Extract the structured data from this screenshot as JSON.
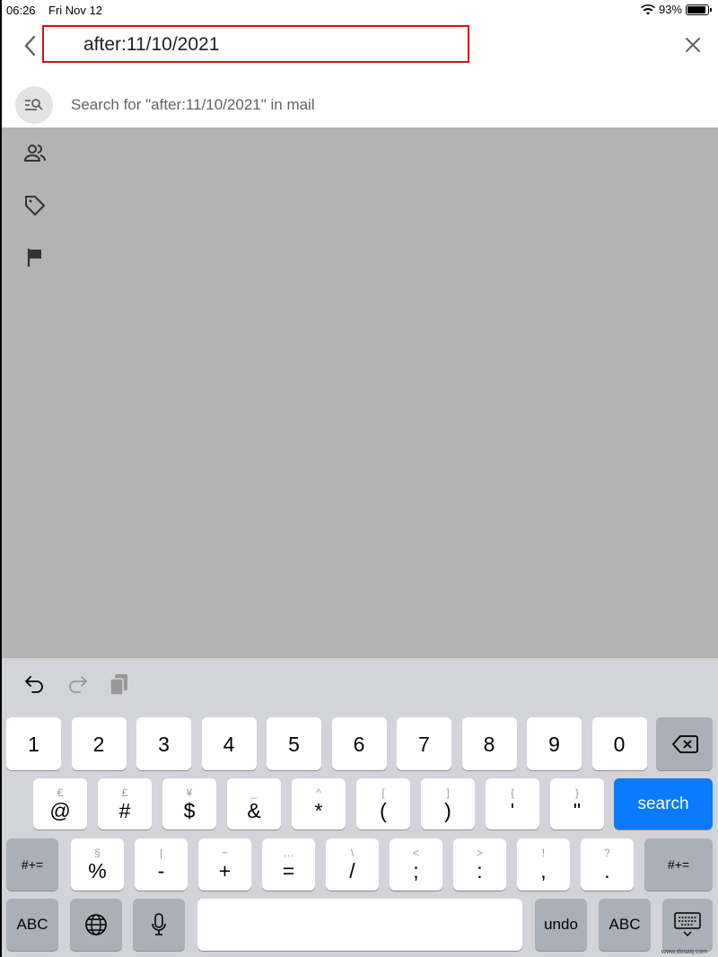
{
  "status_bar": {
    "time": "06:26",
    "date": "Fri Nov 12",
    "battery": "93%",
    "battery_level": 0.93
  },
  "search": {
    "query": "after:11/10/2021",
    "highlight_color": "#d6121a"
  },
  "suggestion": {
    "text": "Search for \"after:11/10/2021\" in mail"
  },
  "side_icons": [
    "people-icon",
    "label-icon",
    "flag-icon"
  ],
  "keyboard": {
    "toolbar": [
      "undo-icon",
      "redo-icon",
      "paste-icon"
    ],
    "row1": [
      "1",
      "2",
      "3",
      "4",
      "5",
      "6",
      "7",
      "8",
      "9",
      "0"
    ],
    "row2": [
      {
        "main": "@",
        "sub": "€"
      },
      {
        "main": "#",
        "sub": "£"
      },
      {
        "main": "$",
        "sub": "¥"
      },
      {
        "main": "&",
        "sub": "_"
      },
      {
        "main": "*",
        "sub": "^"
      },
      {
        "main": "(",
        "sub": "["
      },
      {
        "main": ")",
        "sub": "]"
      },
      {
        "main": "'",
        "sub": "{"
      },
      {
        "main": "\"",
        "sub": "}"
      }
    ],
    "row3": [
      {
        "main": "%",
        "sub": "§"
      },
      {
        "main": "-",
        "sub": "|"
      },
      {
        "main": "+",
        "sub": "~"
      },
      {
        "main": "=",
        "sub": "…"
      },
      {
        "main": "/",
        "sub": "\\"
      },
      {
        "main": ";",
        "sub": "<"
      },
      {
        "main": ":",
        "sub": ">"
      },
      {
        "main": ",",
        "sub": "!"
      },
      {
        "main": ".",
        "sub": "?"
      }
    ],
    "search_label": "search",
    "symbols_label": "#+=",
    "abc_label": "ABC",
    "undo_label": "undo",
    "search_color": "#0a7aff"
  },
  "watermark": "www.dosaq.com"
}
